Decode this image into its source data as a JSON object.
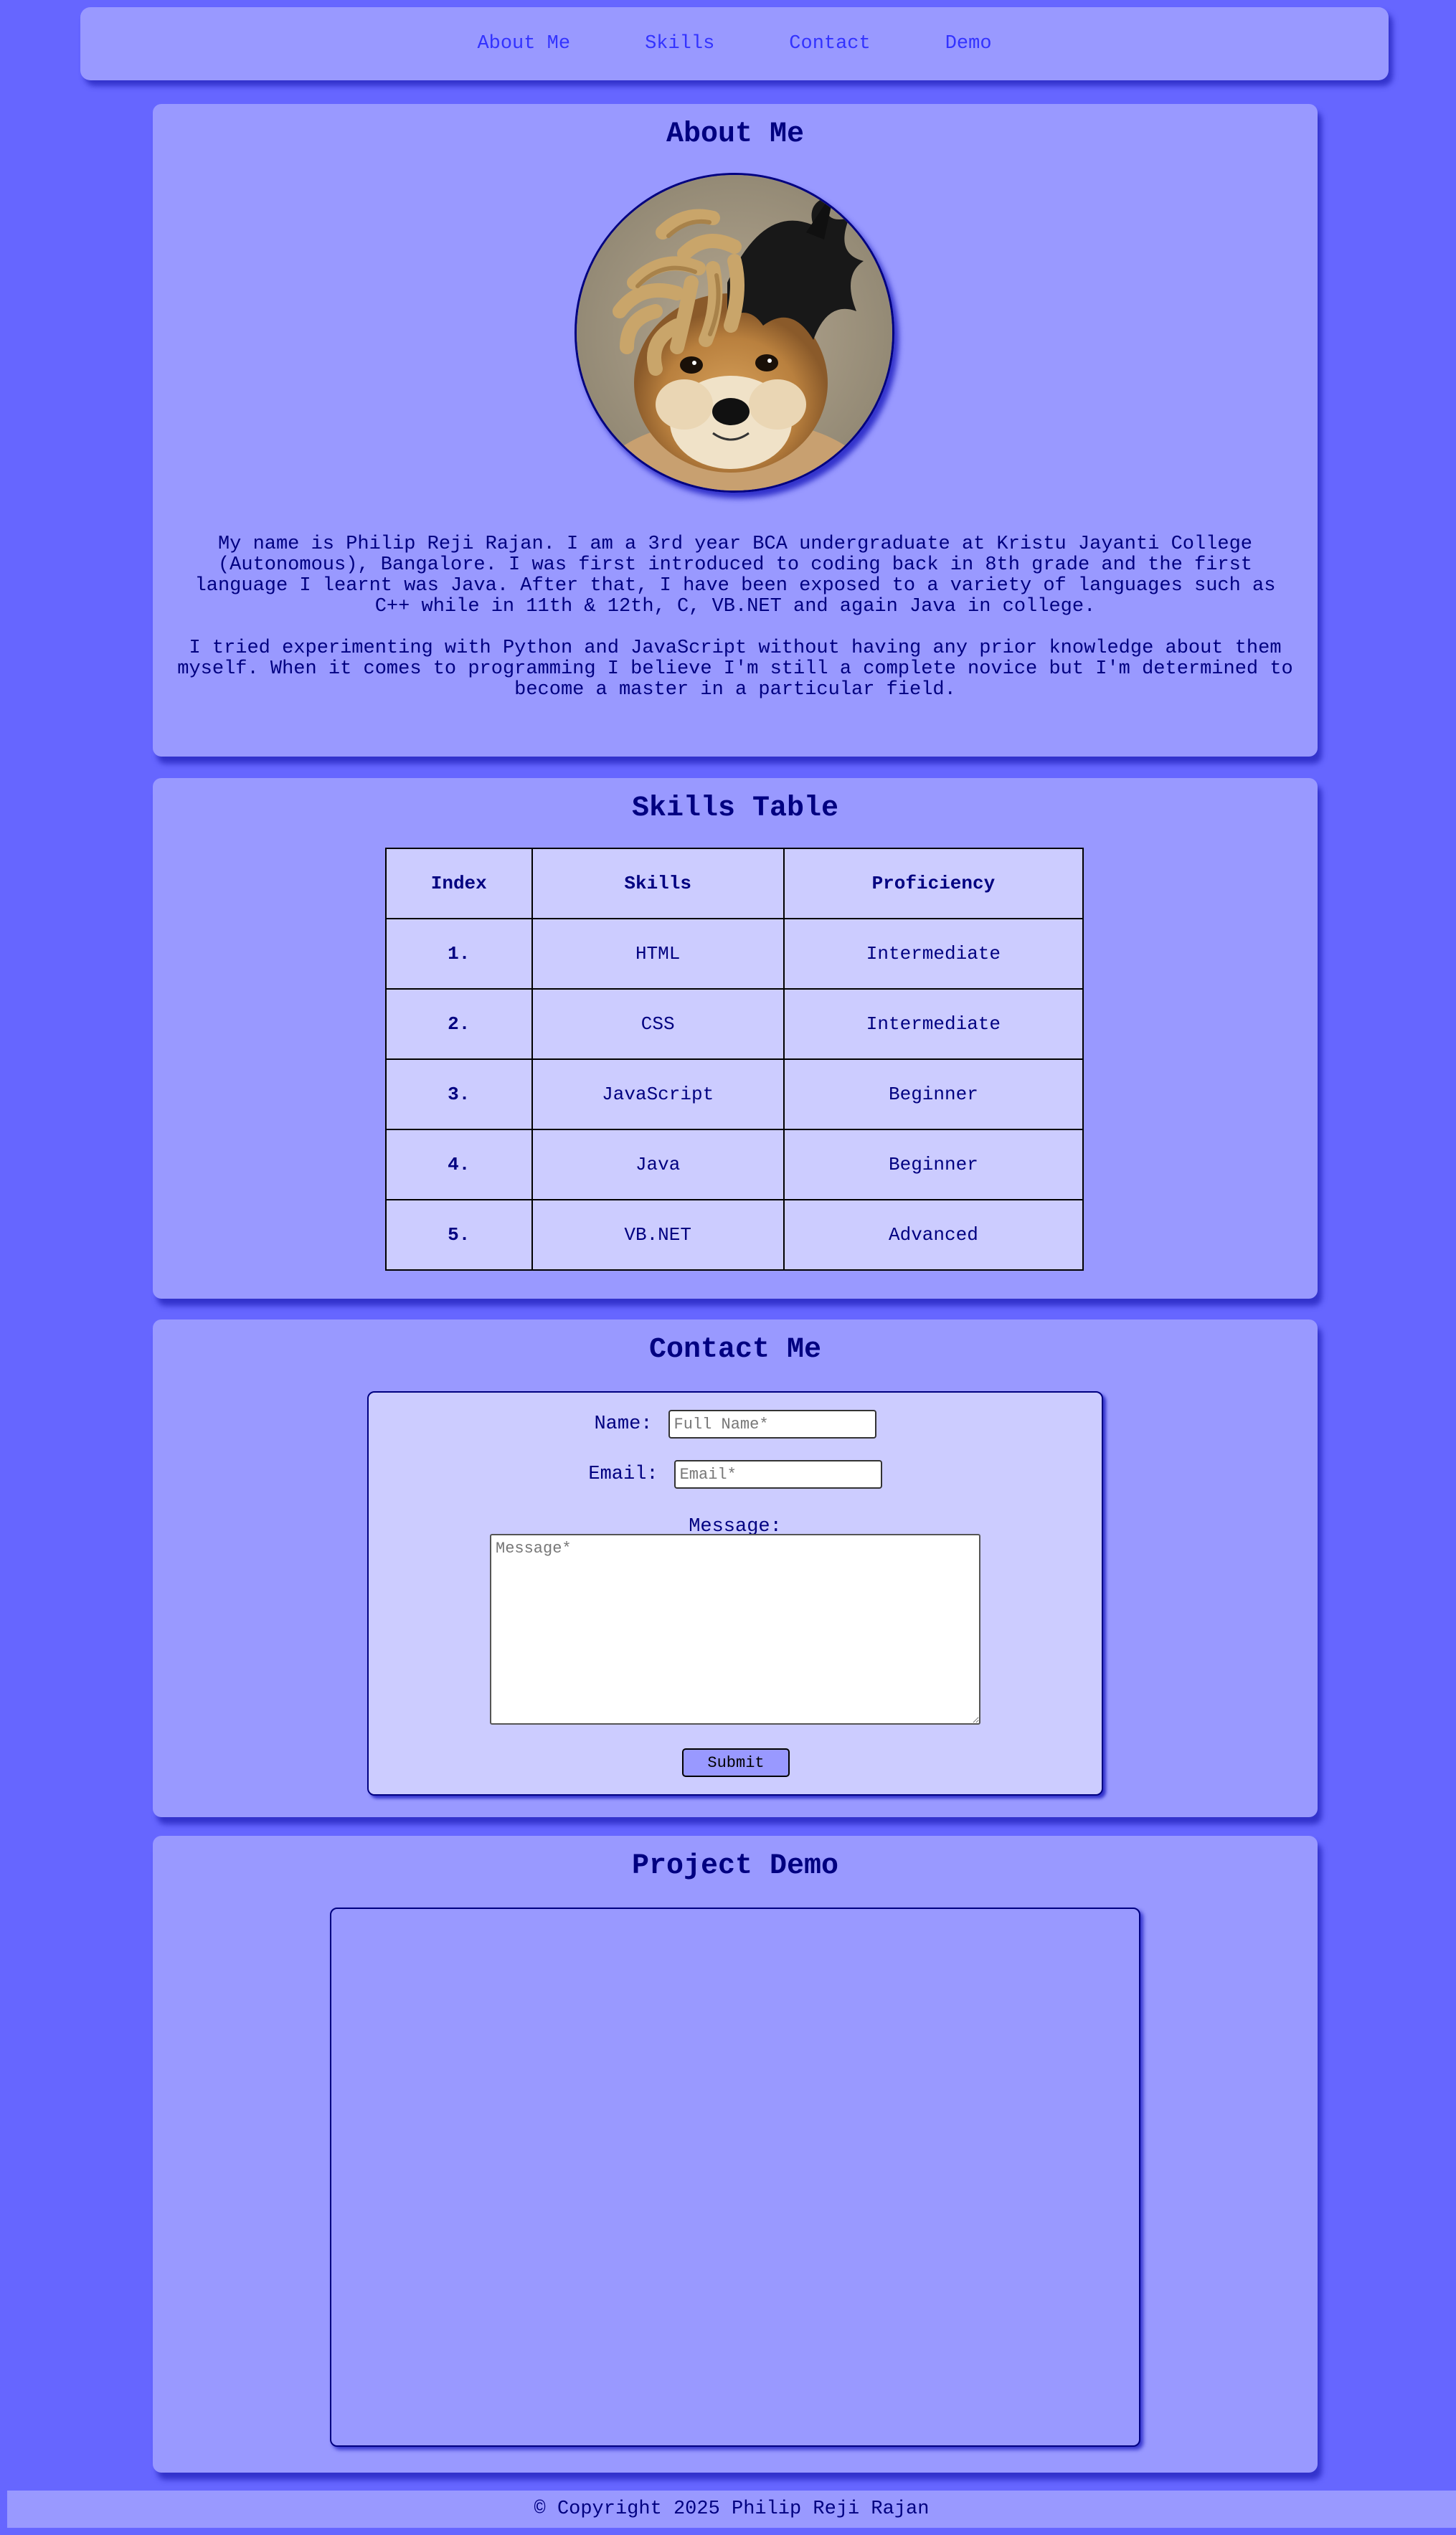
{
  "nav": {
    "links": [
      "About Me",
      "Skills",
      "Contact",
      "Demo"
    ]
  },
  "about": {
    "title": "About Me",
    "avatar_alt": "Profile photo",
    "paragraphs": [
      "My name is Philip Reji Rajan. I am a 3rd year BCA undergraduate at Kristu Jayanti College (Autonomous), Bangalore. I was first introduced to coding back in 8th grade and the first language I learnt was Java. After that, I have been exposed to a variety of languages such as C++ while in 11th & 12th, C, VB.NET and again Java in college.",
      "I tried experimenting with Python and JavaScript without having any prior knowledge about them myself. When it comes to programming I believe I'm still a complete novice but I'm determined to become a master in a particular field."
    ]
  },
  "skills": {
    "title": "Skills Table",
    "headers": [
      "Index",
      "Skills",
      "Proficiency"
    ],
    "rows": [
      {
        "index": "1.",
        "skill": "HTML",
        "proficiency": "Intermediate"
      },
      {
        "index": "2.",
        "skill": "CSS",
        "proficiency": "Intermediate"
      },
      {
        "index": "3.",
        "skill": "JavaScript",
        "proficiency": "Beginner"
      },
      {
        "index": "4.",
        "skill": "Java",
        "proficiency": "Beginner"
      },
      {
        "index": "5.",
        "skill": "VB.NET",
        "proficiency": "Advanced"
      }
    ]
  },
  "contact": {
    "title": "Contact Me",
    "name_label": "Name:",
    "name_placeholder": "Full Name*",
    "email_label": "Email:",
    "email_placeholder": "Email*",
    "message_label": "Message:",
    "message_placeholder": "Message*",
    "submit_label": "Submit"
  },
  "demo": {
    "title": "Project Demo"
  },
  "footer": {
    "text": "© Copyright 2025 Philip Reji Rajan"
  },
  "colors": {
    "page_bg": "#6666ff",
    "card_bg": "#9999ff",
    "light_bg": "#ccccff",
    "text": "#000080",
    "link": "#3333ff"
  }
}
